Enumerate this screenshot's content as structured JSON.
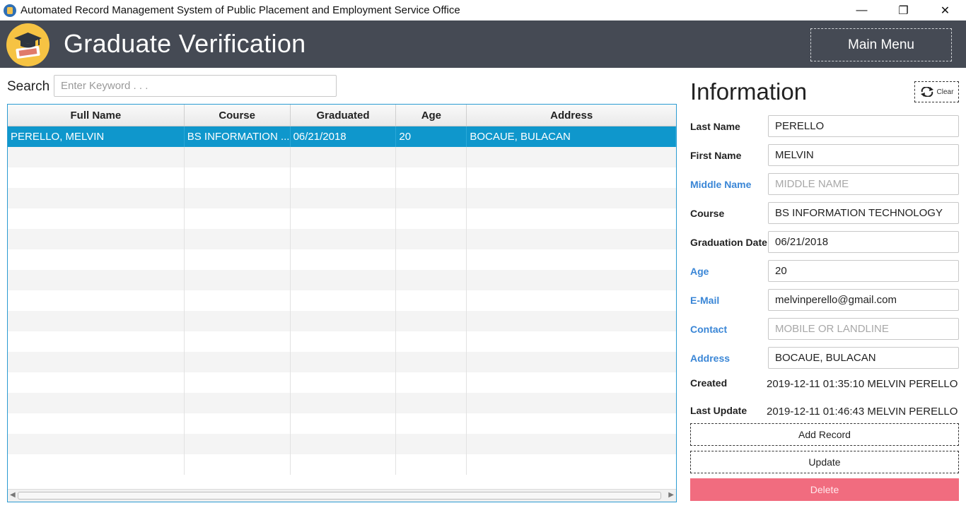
{
  "window": {
    "title": "Automated Record Management System of Public Placement and Employment Service Office",
    "minimize": "—",
    "maximize": "❐",
    "close": "✕"
  },
  "header": {
    "title": "Graduate Verification",
    "main_menu_label": "Main Menu",
    "header_color": "#454a54",
    "logo_color": "#f6c343"
  },
  "search": {
    "label": "Search",
    "placeholder": "Enter Keyword . . .",
    "value": ""
  },
  "table": {
    "columns": [
      "Full Name",
      "Course",
      "Graduated",
      "Age",
      "Address"
    ],
    "rows": [
      [
        "PERELLO, MELVIN",
        "BS INFORMATION ...",
        "06/21/2018",
        "20",
        "BOCAUE, BULACAN"
      ]
    ],
    "selected_row": 0,
    "selection_color": "#0f97cc"
  },
  "info": {
    "title": "Information",
    "clear_label": "Clear",
    "fields": [
      {
        "label": "Last Name",
        "value": "PERELLO",
        "placeholder": "",
        "required": true
      },
      {
        "label": "First Name",
        "value": "MELVIN",
        "placeholder": "",
        "required": true
      },
      {
        "label": "Middle Name",
        "value": "",
        "placeholder": "MIDDLE NAME",
        "required": false
      },
      {
        "label": "Course",
        "value": "BS INFORMATION TECHNOLOGY",
        "placeholder": "",
        "required": true
      },
      {
        "label": "Graduation Date",
        "value": "06/21/2018",
        "placeholder": "",
        "required": true
      },
      {
        "label": "Age",
        "value": "20",
        "placeholder": "",
        "required": false
      },
      {
        "label": "E-Mail",
        "value": "melvinperello@gmail.com",
        "placeholder": "",
        "required": false
      },
      {
        "label": "Contact",
        "value": "",
        "placeholder": "MOBILE OR LANDLINE",
        "required": false
      },
      {
        "label": "Address",
        "value": "BOCAUE, BULACAN",
        "placeholder": "",
        "required": false
      }
    ],
    "created_label": "Created",
    "created_value": "2019-12-11 01:35:10 MELVIN PERELLO",
    "updated_label": "Last Update",
    "updated_value": "2019-12-11 01:46:43 MELVIN PERELLO",
    "add_label": "Add Record",
    "update_label": "Update",
    "delete_label": "Delete",
    "optional_label_color": "#3a86d6",
    "delete_color": "#f16c7f"
  }
}
